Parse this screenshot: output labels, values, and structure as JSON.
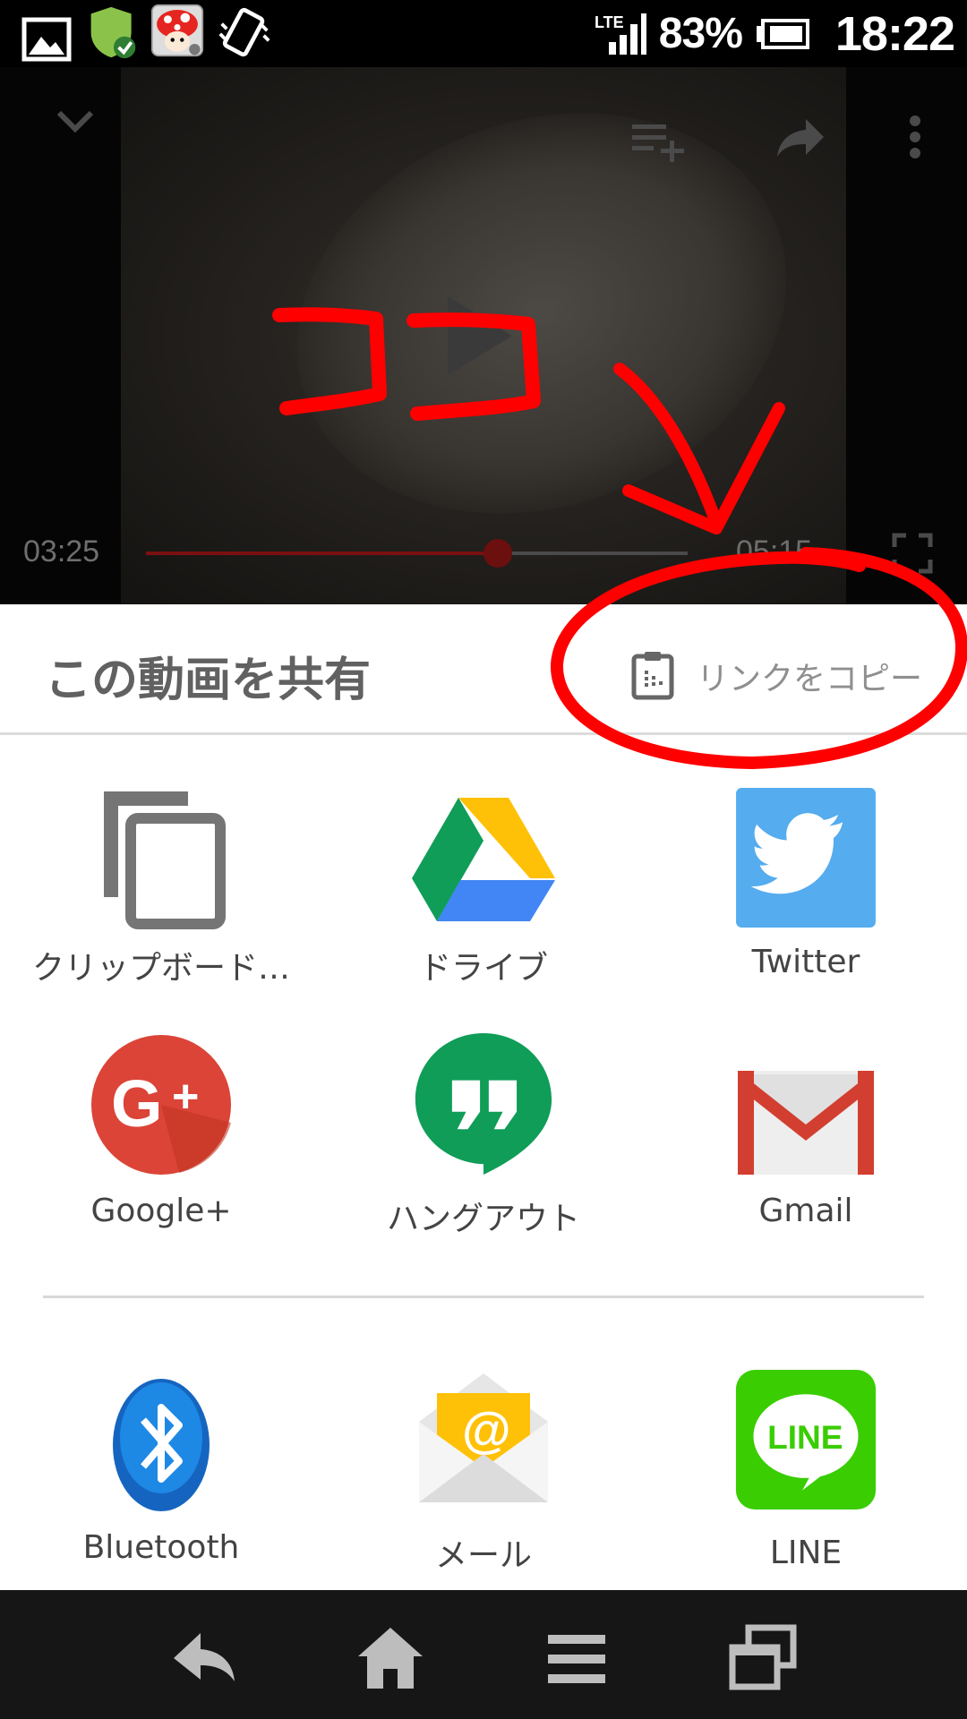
{
  "status_bar": {
    "network": "LTE",
    "battery_percent": "83%",
    "time": "18:22",
    "icons": [
      "gallery-icon",
      "shield-check-icon",
      "mushroom-app-icon",
      "vibrate-icon"
    ]
  },
  "video": {
    "elapsed": "03:25",
    "duration": "05:15",
    "progress": 0.65,
    "icons": [
      "chevron-down-icon",
      "add-to-playlist-icon",
      "share-arrow-icon",
      "more-vert-icon",
      "play-icon",
      "fullscreen-icon"
    ]
  },
  "share_sheet": {
    "title": "この動画を共有",
    "copy_link_label": "リンクをコピー",
    "apps_primary": [
      {
        "label": "クリップボード…",
        "icon": "clipboard-copy-icon"
      },
      {
        "label": "ドライブ",
        "icon": "google-drive-icon"
      },
      {
        "label": "Twitter",
        "icon": "twitter-icon"
      },
      {
        "label": "Google+",
        "icon": "google-plus-icon"
      },
      {
        "label": "ハングアウト",
        "icon": "hangouts-icon"
      },
      {
        "label": "Gmail",
        "icon": "gmail-icon"
      }
    ],
    "apps_secondary": [
      {
        "label": "Bluetooth",
        "icon": "bluetooth-icon"
      },
      {
        "label": "メール",
        "icon": "email-icon"
      },
      {
        "label": "LINE",
        "icon": "line-icon"
      }
    ]
  },
  "annotation": {
    "text": "ココ",
    "color": "#ff0000"
  },
  "nav_bar": {
    "icons": [
      "back-icon",
      "home-icon",
      "menu-icon",
      "recents-icon"
    ]
  },
  "colors": {
    "twitter": "#55acee",
    "google_plus": "#db4437",
    "hangouts": "#0f9d58",
    "line": "#3acd01",
    "gmail_red": "#d23f31"
  }
}
